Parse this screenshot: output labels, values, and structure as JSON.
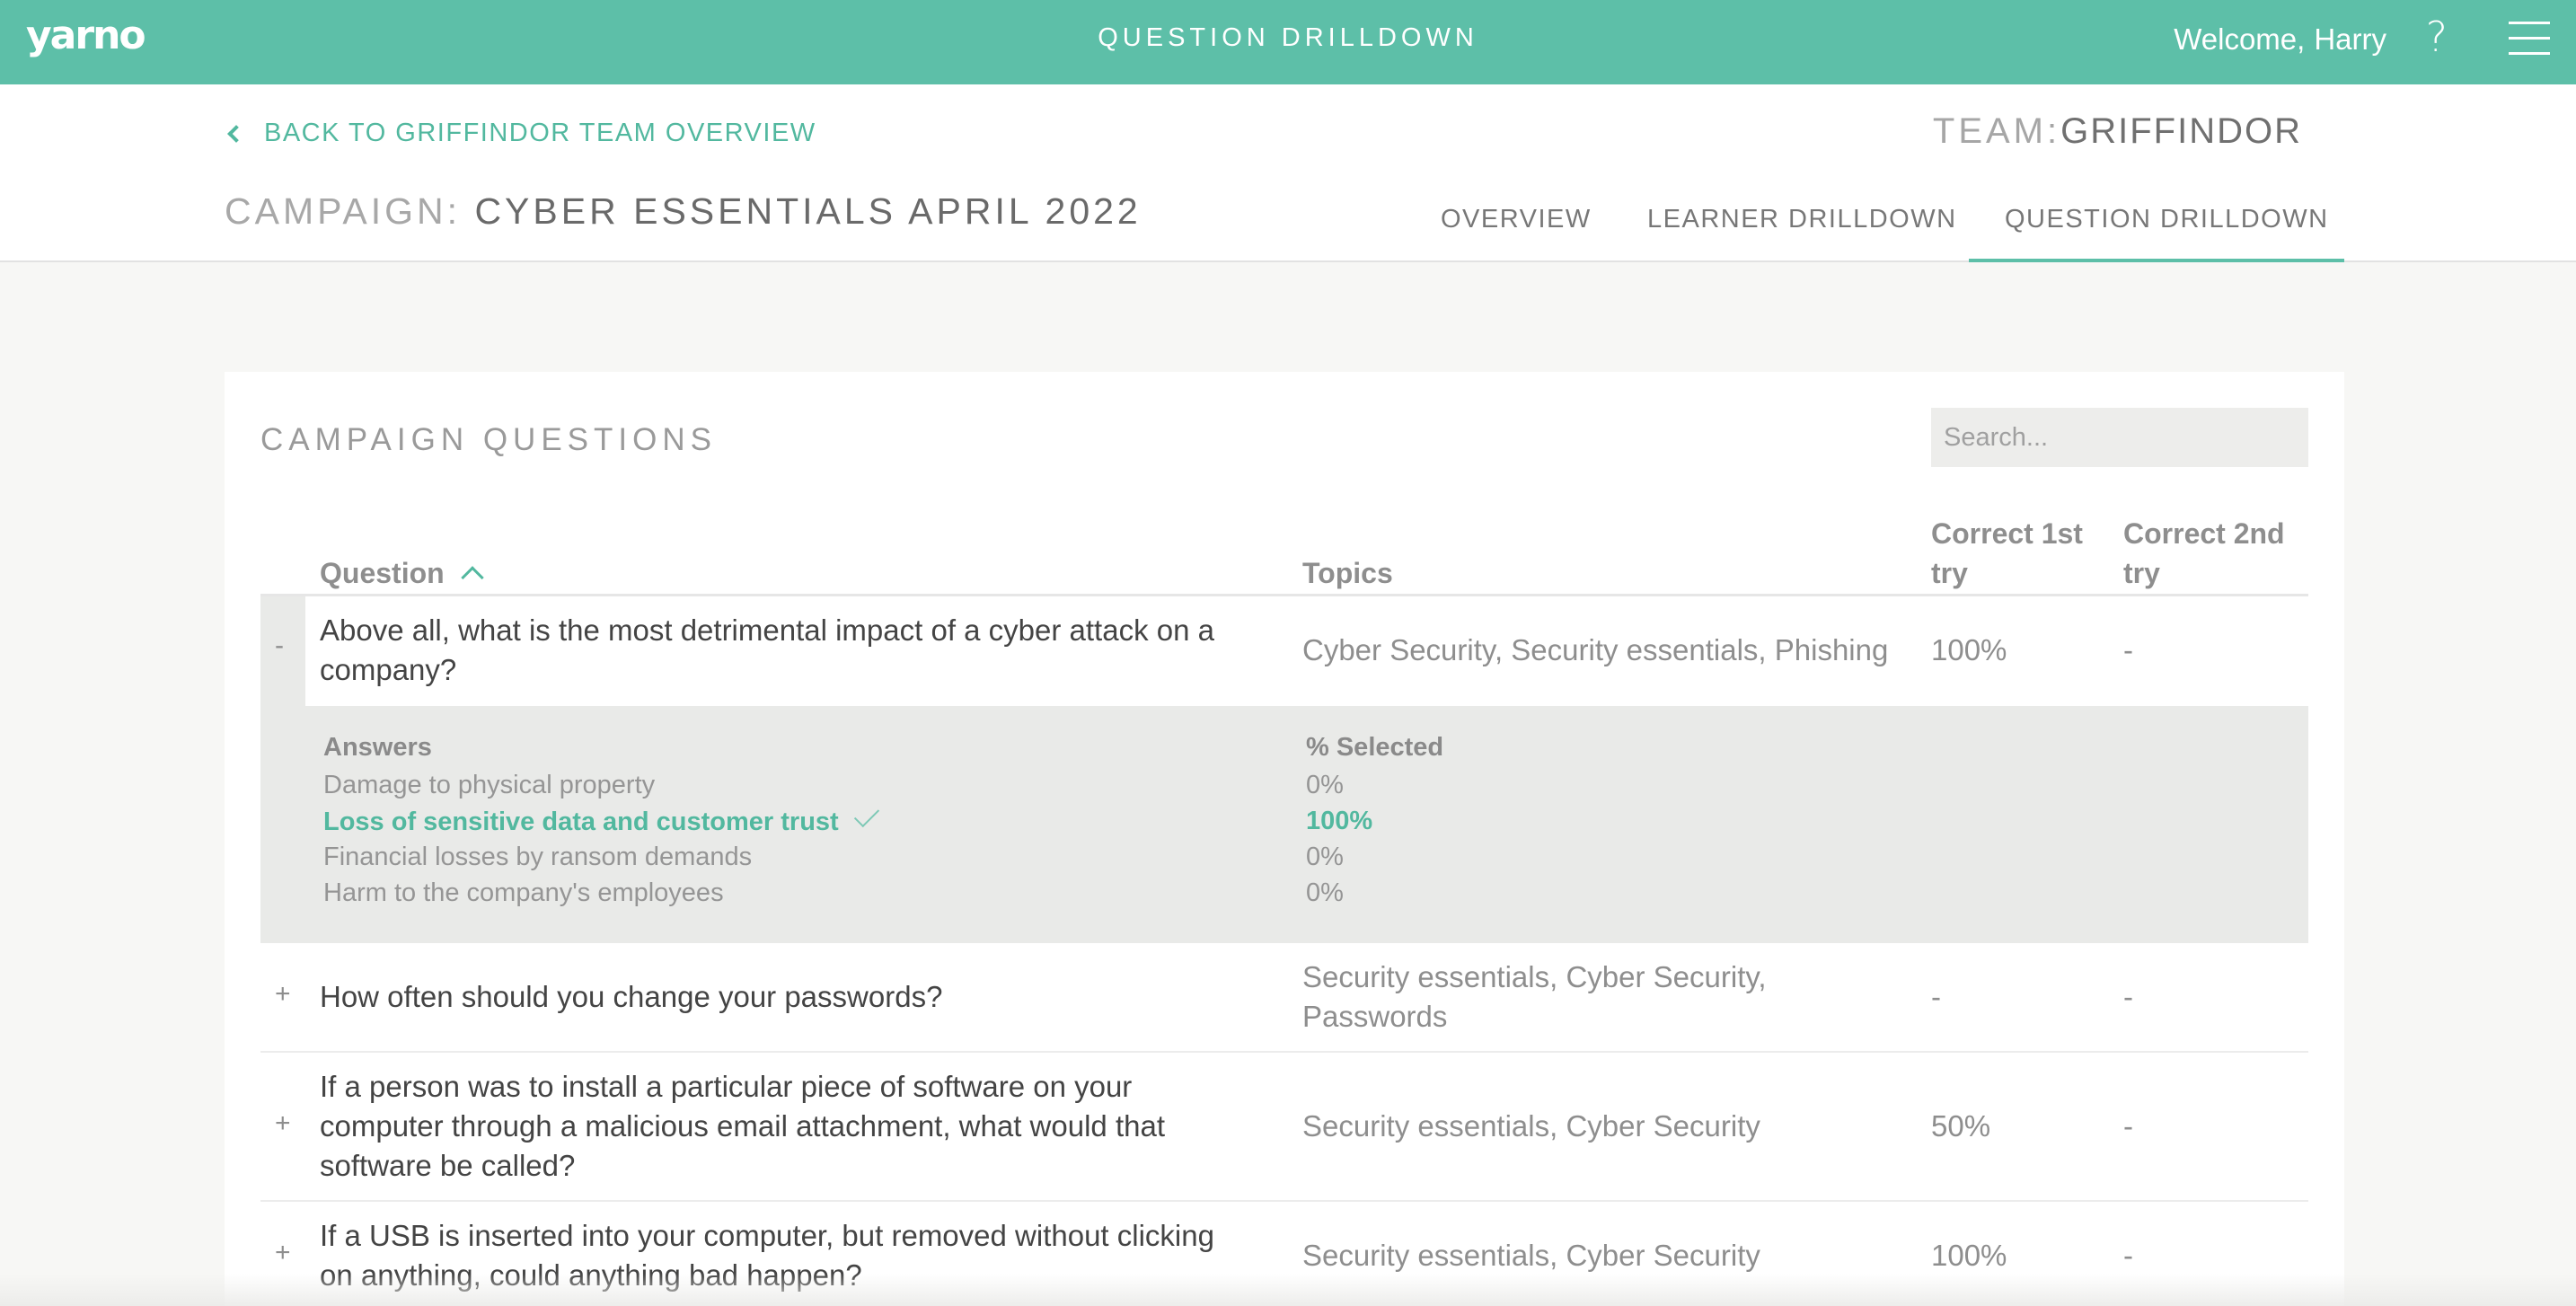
{
  "topbar": {
    "logo": "yarno",
    "title": "QUESTION DRILLDOWN",
    "welcome_prefix": "Welcome,",
    "user_name": "Harry",
    "help_glyph": "?"
  },
  "header": {
    "back_link": "BACK TO GRIFFINDOR TEAM OVERVIEW",
    "team_label": "TEAM:",
    "team_name": "GRIFFINDOR",
    "campaign_label": "CAMPAIGN:",
    "campaign_name": "CYBER ESSENTIALS APRIL 2022",
    "tabs": [
      {
        "label": "OVERVIEW",
        "active": false
      },
      {
        "label": "LEARNER DRILLDOWN",
        "active": false
      },
      {
        "label": "QUESTION DRILLDOWN",
        "active": true
      }
    ]
  },
  "card": {
    "title": "CAMPAIGN QUESTIONS",
    "search_placeholder": "Search...",
    "columns": {
      "question": "Question",
      "topics": "Topics",
      "correct_1st_line1": "Correct 1st",
      "correct_1st_line2": "try",
      "correct_2nd_line1": "Correct 2nd",
      "correct_2nd_line2": "try"
    },
    "rows": [
      {
        "toggle": "-",
        "question_l1": "Above all, what is the most detrimental impact of a cyber attack on a",
        "question_l2": "company?",
        "topics_l1": "Cyber Security, Security essentials, Phishing",
        "first": "100%",
        "second": "-"
      },
      {
        "toggle": "+",
        "question_l1": "How often should you change your passwords?",
        "topics_l1": "Security essentials, Cyber Security,",
        "topics_l2": "Passwords",
        "first": "-",
        "second": "-"
      },
      {
        "toggle": "+",
        "question_l1": "If a person was to install a particular piece of software on your",
        "question_l2": "computer through a malicious email attachment, what would that",
        "question_l3": "software be called?",
        "topics_l1": "Security essentials, Cyber Security",
        "first": "50%",
        "second": "-"
      },
      {
        "toggle": "+",
        "question_l1": "If a USB is inserted into your computer, but removed without clicking",
        "question_l2": "on anything, could anything bad happen?",
        "topics_l1": "Security essentials, Cyber Security",
        "first": "100%",
        "second": "-"
      }
    ],
    "answers": {
      "header_answers": "Answers",
      "header_selected": "% Selected",
      "items": [
        {
          "text": "Damage to physical property",
          "pct": "0%",
          "correct": false
        },
        {
          "text": "Loss of sensitive data and customer trust",
          "pct": "100%",
          "correct": true
        },
        {
          "text": "Financial losses by ransom demands",
          "pct": "0%",
          "correct": false
        },
        {
          "text": "Harm to the company's employees",
          "pct": "0%",
          "correct": false
        }
      ]
    }
  },
  "colors": {
    "brand": "#5dbfa8",
    "accent_text": "#52b89f"
  }
}
